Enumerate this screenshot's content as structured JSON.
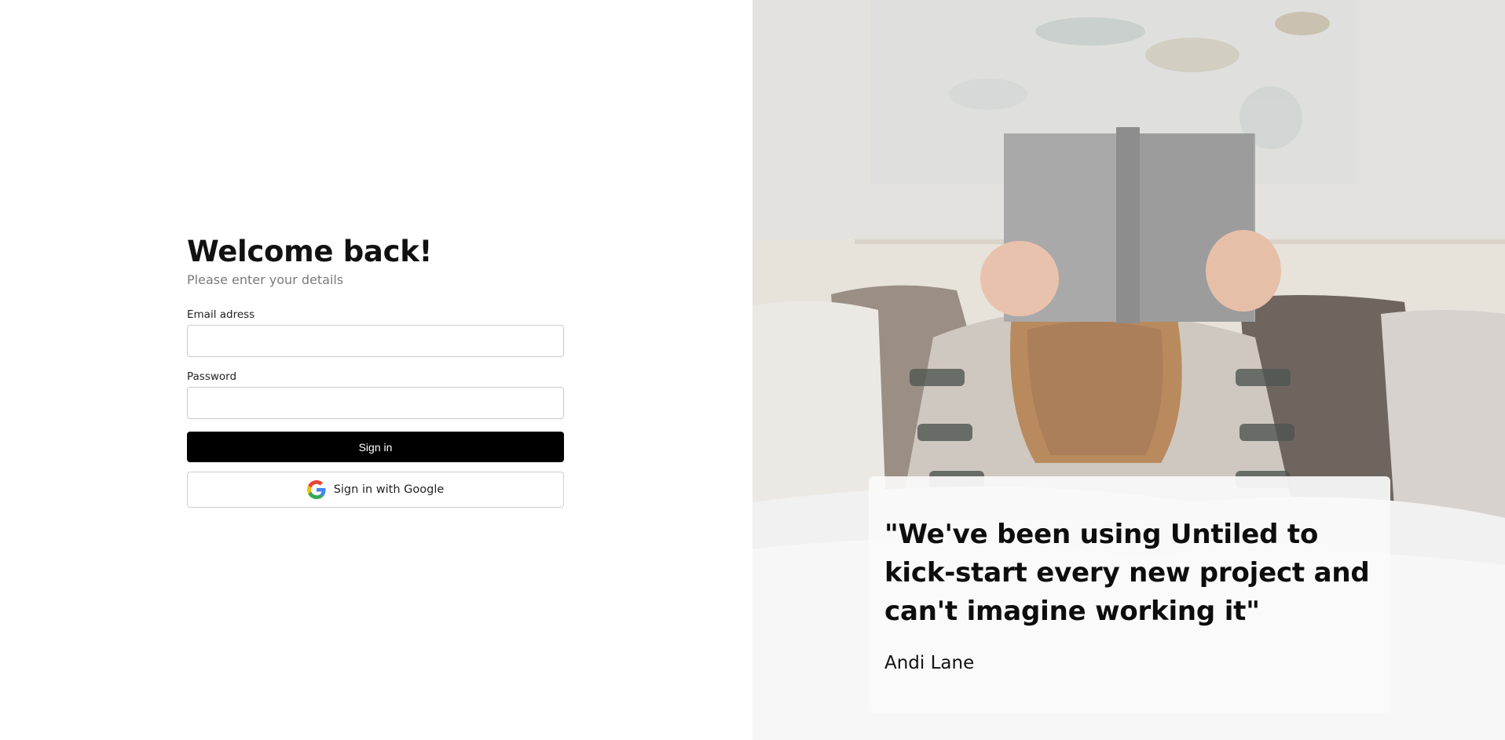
{
  "login": {
    "title": "Welcome back!",
    "subtitle": "Please enter your details",
    "email_label": "Email adress",
    "email_value": "",
    "password_label": "Password",
    "password_value": "",
    "signin_label": "Sign in",
    "google_label": "Sign in with Google",
    "google_icon": "google-icon"
  },
  "testimonial": {
    "quote": "\"We've been using Untiled to kick-start every new project and can't imagine working it\"",
    "author": "Andi Lane"
  },
  "colors": {
    "primary_button": "#000000",
    "muted_text": "#7a7a7a",
    "border": "#c9c9c9"
  }
}
